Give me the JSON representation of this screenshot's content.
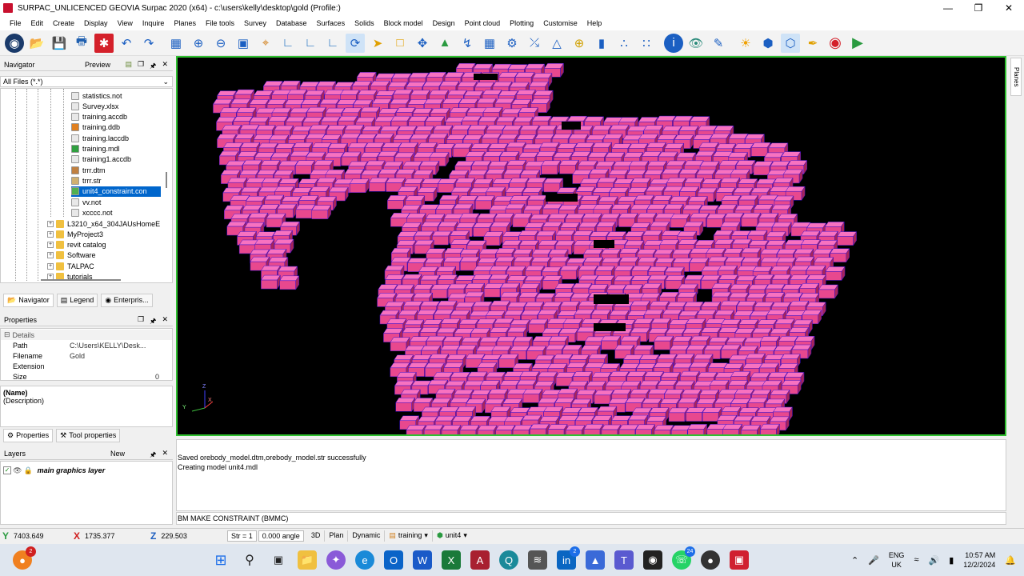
{
  "window": {
    "title": "SURPAC_UNLICENCED GEOVIA Surpac 2020 (x64) - c:\\users\\kelly\\desktop\\gold (Profile:)"
  },
  "menu": [
    "File",
    "Edit",
    "Create",
    "Display",
    "View",
    "Inquire",
    "Planes",
    "File tools",
    "Survey",
    "Database",
    "Surfaces",
    "Solids",
    "Block model",
    "Design",
    "Point cloud",
    "Plotting",
    "Customise",
    "Help"
  ],
  "navigator": {
    "title": "Navigator",
    "preview_label": "Preview",
    "filter": "All Files (*.*)",
    "files": [
      {
        "name": "statistics.not",
        "icon": "note-file-icon"
      },
      {
        "name": "Survey.xlsx",
        "icon": "excel-file-icon"
      },
      {
        "name": "training.accdb",
        "icon": "access-file-icon"
      },
      {
        "name": "training.ddb",
        "icon": "ddb-file-icon"
      },
      {
        "name": "training.laccdb",
        "icon": "lock-file-icon"
      },
      {
        "name": "training.mdl",
        "icon": "block-model-icon"
      },
      {
        "name": "training1.accdb",
        "icon": "access-file-icon"
      },
      {
        "name": "trrr.dtm",
        "icon": "dtm-file-icon"
      },
      {
        "name": "trrr.str",
        "icon": "string-file-icon"
      },
      {
        "name": "unit4_constraint.con",
        "icon": "constraint-file-icon",
        "selected": true
      },
      {
        "name": "vv.not",
        "icon": "note-file-icon"
      },
      {
        "name": "xcccc.not",
        "icon": "note-file-icon"
      }
    ],
    "folders": [
      "L3210_x64_304JAUsHomeE",
      "MyProject3",
      "revit catalog",
      "Software",
      "TALPAC",
      "tutorials"
    ],
    "tabs": [
      "Navigator",
      "Legend",
      "Enterpris..."
    ]
  },
  "properties": {
    "title": "Properties",
    "section": "Details",
    "rows": [
      {
        "key": "Path",
        "value": "C:\\Users\\KELLY\\Desk..."
      },
      {
        "key": "Filename",
        "value": "Gold"
      },
      {
        "key": "Extension",
        "value": ""
      },
      {
        "key": "Size",
        "value": "0"
      }
    ],
    "name_label": "(Name)",
    "description_label": "(Description)",
    "tabs": [
      "Properties",
      "Tool properties"
    ]
  },
  "layers": {
    "title": "Layers",
    "new_label": "New",
    "items": [
      "main graphics layer"
    ]
  },
  "viewport": {
    "axis_labels": [
      "Z",
      "Y",
      "X"
    ]
  },
  "planes_tab": "Planes",
  "messages": [
    "Saved orebody_model.dtm,orebody_model.str successfully",
    "Creating model unit4.mdl"
  ],
  "command_line": "BM MAKE CONSTRAINT (BMMC)",
  "status": {
    "y": "7403.649",
    "x": "1735.377",
    "z": "229.503",
    "str_label": "Str = 1",
    "angle": "0.000 angle",
    "mode_3d": "3D",
    "plan": "Plan",
    "dynamic": "Dynamic",
    "database": "training",
    "model": "unit4"
  },
  "taskbar": {
    "badges": {
      "notify": "2",
      "linkedin": "2",
      "whatsapp": "24"
    },
    "lang": "ENG",
    "region": "UK",
    "time": "10:57 AM",
    "date": "12/2/2024"
  },
  "colors": {
    "viewport_bg": "#000000",
    "block_top": "#f872c0",
    "block_front": "#e8488e",
    "block_side": "#a8245a",
    "block_edge": "#3a10c8",
    "viewport_border": "#30c030"
  }
}
